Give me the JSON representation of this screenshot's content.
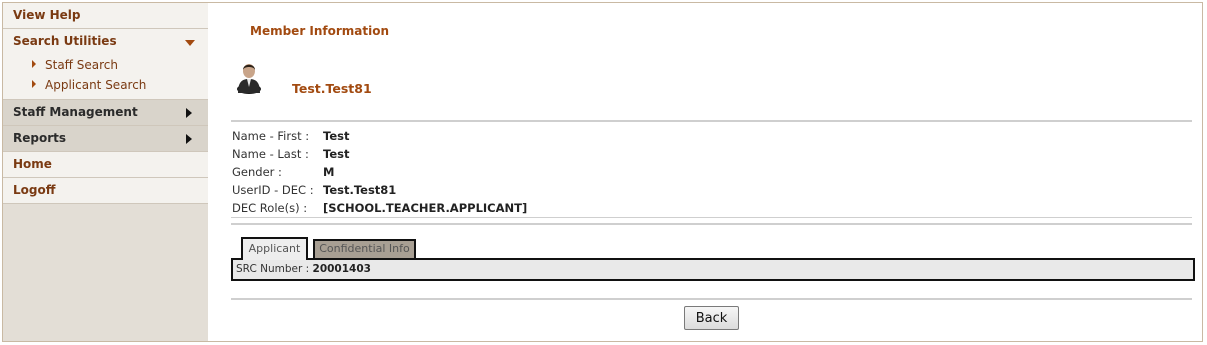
{
  "sidebar": {
    "view_help": "View Help",
    "search_utilities": {
      "label": "Search Utilities",
      "items": [
        "Staff Search",
        "Applicant Search"
      ]
    },
    "staff_management": "Staff Management",
    "reports": "Reports",
    "home": "Home",
    "logoff": "Logoff"
  },
  "main": {
    "title": "Member Information",
    "username": "Test.Test81",
    "fields": [
      {
        "label": "Name - First :",
        "value": "Test"
      },
      {
        "label": "Name - Last :",
        "value": "Test"
      },
      {
        "label": "Gender :",
        "value": "M"
      },
      {
        "label": "UserID - DEC :",
        "value": "Test.Test81"
      },
      {
        "label": "DEC Role(s) :",
        "value": "[SCHOOL.TEACHER.APPLICANT]"
      }
    ],
    "tabs": [
      {
        "label": "Applicant",
        "active": true
      },
      {
        "label": "Confidential Info",
        "active": false
      }
    ],
    "panel": {
      "label": "SRC Number :",
      "value": "20001403"
    },
    "back_label": "Back"
  },
  "colors": {
    "accent": "#a24a10",
    "sidebar_bg": "#e3ded6",
    "inactive_tab": "#a89f93"
  }
}
